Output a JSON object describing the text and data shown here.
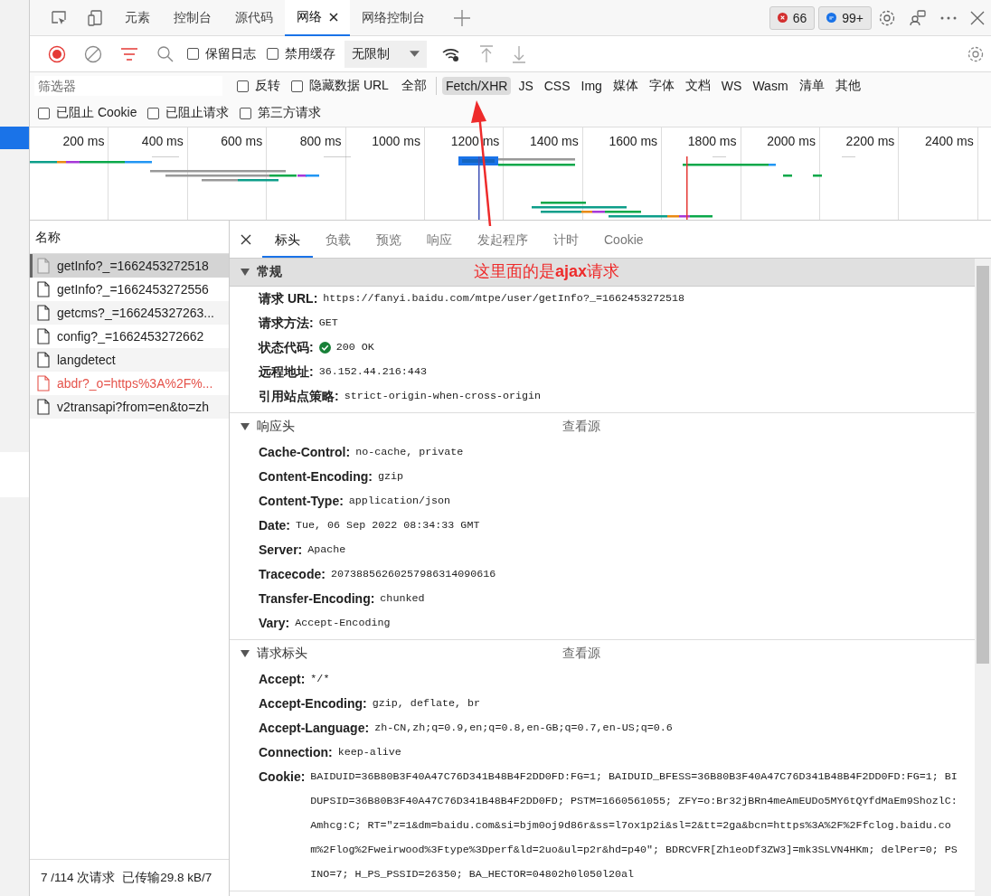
{
  "devtools_tabs": [
    {
      "label": "元素",
      "selected": false
    },
    {
      "label": "控制台",
      "selected": false
    },
    {
      "label": "源代码",
      "selected": false
    },
    {
      "label": "网络",
      "selected": true
    },
    {
      "label": "网络控制台",
      "selected": false
    }
  ],
  "badges": {
    "errors": "66",
    "messages": "99+"
  },
  "toolbar": {
    "recording": true,
    "checkboxes": [
      {
        "label": "保留日志",
        "checked": false
      },
      {
        "label": "禁用缓存",
        "checked": false
      }
    ],
    "throttle": "无限制"
  },
  "filter": {
    "placeholder": "筛选器",
    "checkboxes": [
      {
        "label": "反转",
        "checked": false
      },
      {
        "label": "隐藏数据 URL",
        "checked": false
      }
    ],
    "types": [
      {
        "label": "全部",
        "selected": false
      },
      {
        "label": "Fetch/XHR",
        "selected": true
      },
      {
        "label": "JS",
        "selected": false
      },
      {
        "label": "CSS",
        "selected": false
      },
      {
        "label": "Img",
        "selected": false
      },
      {
        "label": "媒体",
        "selected": false
      },
      {
        "label": "字体",
        "selected": false
      },
      {
        "label": "文档",
        "selected": false
      },
      {
        "label": "WS",
        "selected": false
      },
      {
        "label": "Wasm",
        "selected": false
      },
      {
        "label": "清单",
        "selected": false
      },
      {
        "label": "其他",
        "selected": false
      }
    ],
    "blocked": [
      {
        "label": "已阻止 Cookie",
        "checked": false
      },
      {
        "label": "已阻止请求",
        "checked": false
      },
      {
        "label": "第三方请求",
        "checked": false
      }
    ]
  },
  "waterfall": {
    "ticks": [
      "200 ms",
      "400 ms",
      "600 ms",
      "800 ms",
      "1000 ms",
      "1200 ms",
      "1400 ms",
      "1600 ms",
      "1800 ms",
      "2000 ms",
      "2200 ms",
      "2400 ms"
    ]
  },
  "requests": {
    "header": "名称",
    "items": [
      {
        "name": "getInfo?_=1662453272518",
        "selected": true,
        "failed": false
      },
      {
        "name": "getInfo?_=1662453272556",
        "selected": false,
        "failed": false
      },
      {
        "name": "getcms?_=166245327263...",
        "selected": false,
        "failed": false
      },
      {
        "name": "config?_=1662453272662",
        "selected": false,
        "failed": false
      },
      {
        "name": "langdetect",
        "selected": false,
        "failed": false
      },
      {
        "name": "abdr?_o=https%3A%2F%...",
        "selected": false,
        "failed": true
      },
      {
        "name": "v2transapi?from=en&to=zh",
        "selected": false,
        "failed": false
      }
    ],
    "count": "7 /114 次请求",
    "transferred": "已传输29.8 kB/7"
  },
  "details": {
    "tabs": [
      {
        "label": "标头",
        "selected": true
      },
      {
        "label": "负载",
        "selected": false
      },
      {
        "label": "预览",
        "selected": false
      },
      {
        "label": "响应",
        "selected": false
      },
      {
        "label": "发起程序",
        "selected": false
      },
      {
        "label": "计时",
        "selected": false
      },
      {
        "label": "Cookie",
        "selected": false
      }
    ],
    "sections": [
      {
        "title": "常规",
        "kind": "general",
        "expanded": true,
        "rows": [
          {
            "name": "请求 URL:",
            "value": "https://fanyi.baidu.com/mtpe/user/getInfo?_=1662453272518",
            "kind": "plain"
          },
          {
            "name": "请求方法:",
            "value": "GET",
            "kind": "plain"
          },
          {
            "name": "状态代码:",
            "value": "200 OK",
            "kind": "status"
          },
          {
            "name": "远程地址:",
            "value": "36.152.44.216:443",
            "kind": "plain"
          },
          {
            "name": "引用站点策略:",
            "value": "strict-origin-when-cross-origin",
            "kind": "plain"
          }
        ]
      },
      {
        "title": "响应头",
        "kind": "headers",
        "expanded": true,
        "view_source": "查看源",
        "rows": [
          {
            "name": "Cache-Control:",
            "value": "no-cache, private",
            "kind": "plain"
          },
          {
            "name": "Content-Encoding:",
            "value": "gzip",
            "kind": "plain"
          },
          {
            "name": "Content-Type:",
            "value": "application/json",
            "kind": "plain"
          },
          {
            "name": "Date:",
            "value": "Tue, 06 Sep 2022 08:34:33 GMT",
            "kind": "plain"
          },
          {
            "name": "Server:",
            "value": "Apache",
            "kind": "plain"
          },
          {
            "name": "Tracecode:",
            "value": "20738856260257986314090616",
            "kind": "plain"
          },
          {
            "name": "Transfer-Encoding:",
            "value": "chunked",
            "kind": "plain"
          },
          {
            "name": "Vary:",
            "value": "Accept-Encoding",
            "kind": "plain"
          }
        ]
      },
      {
        "title": "请求标头",
        "kind": "headers",
        "expanded": true,
        "view_source": "查看源",
        "rows": [
          {
            "name": "Accept:",
            "value": "*/*",
            "kind": "plain"
          },
          {
            "name": "Accept-Encoding:",
            "value": "gzip, deflate, br",
            "kind": "plain"
          },
          {
            "name": "Accept-Language:",
            "value": "zh-CN,zh;q=0.9,en;q=0.8,en-GB;q=0.7,en-US;q=0.6",
            "kind": "plain"
          },
          {
            "name": "Connection:",
            "value": "keep-alive",
            "kind": "plain"
          },
          {
            "name": "Cookie:",
            "value": "BAIDUID=36B80B3F40A47C76D341B48B4F2DD0FD:FG=1; BAIDUID_BFESS=36B80B3F40A47C76D341B48B4F2DD0FD:FG=1; BIDUPSID=36B80B3F40A47C76D341B48B4F2DD0FD; PSTM=1660561055; ZFY=o:Br32jBRn4meAmEUDo5MY6tQYfdMaEm9ShozlC:Amhcg:C; RT=\"z=1&dm=baidu.com&si=bjm0oj9d86r&ss=l7ox1p2i&sl=2&tt=2ga&bcn=https%3A%2F%2Ffclog.baidu.com%2Flog%2Fweirwood%3Ftype%3Dperf&ld=2uo&ul=p2r&hd=p40\"; BDRCVFR[Zh1eoDf3ZW3]=mk3SLVN4HKm; delPer=0; PSINO=7; H_PS_PSSID=26350; BA_HECTOR=04802h0l050l20al",
            "kind": "plain"
          }
        ]
      }
    ]
  },
  "annotation": {
    "text": "这里面的是**ajax**请求"
  }
}
